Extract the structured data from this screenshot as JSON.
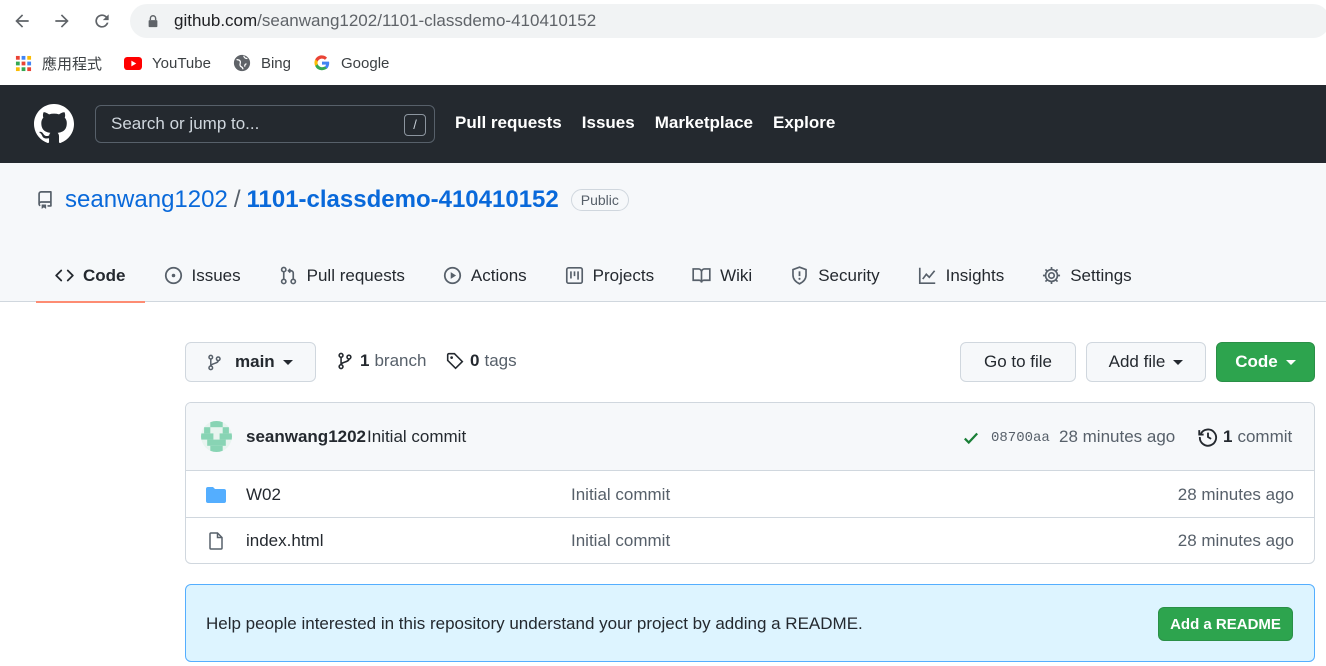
{
  "browser": {
    "url_host": "github.com",
    "url_path": "/seanwang1202/1101-classdemo-410410152",
    "bookmarks": [
      {
        "label": "應用程式",
        "icon": "apps-grid-icon"
      },
      {
        "label": "YouTube",
        "icon": "youtube-icon"
      },
      {
        "label": "Bing",
        "icon": "globe-icon"
      },
      {
        "label": "Google",
        "icon": "google-icon"
      }
    ]
  },
  "header": {
    "search_placeholder": "Search or jump to...",
    "search_shortcut": "/",
    "nav": [
      "Pull requests",
      "Issues",
      "Marketplace",
      "Explore"
    ]
  },
  "repo": {
    "owner": "seanwang1202",
    "separator": "/",
    "name": "1101-classdemo-410410152",
    "visibility": "Public",
    "tabs": [
      {
        "label": "Code",
        "icon": "code-icon",
        "active": true
      },
      {
        "label": "Issues",
        "icon": "issue-icon"
      },
      {
        "label": "Pull requests",
        "icon": "pull-request-icon"
      },
      {
        "label": "Actions",
        "icon": "play-icon"
      },
      {
        "label": "Projects",
        "icon": "project-icon"
      },
      {
        "label": "Wiki",
        "icon": "book-icon"
      },
      {
        "label": "Security",
        "icon": "shield-icon"
      },
      {
        "label": "Insights",
        "icon": "graph-icon"
      },
      {
        "label": "Settings",
        "icon": "gear-icon"
      }
    ]
  },
  "toolbar": {
    "branch": "main",
    "branch_count": "1",
    "branch_word": "branch",
    "tag_count": "0",
    "tag_word": "tags",
    "goto_file": "Go to file",
    "add_file": "Add file",
    "code": "Code"
  },
  "latest_commit": {
    "author": "seanwang1202",
    "message": "Initial commit",
    "sha": "08700aa",
    "age": "28 minutes ago",
    "commit_count": "1",
    "commit_word": "commit"
  },
  "files": [
    {
      "name": "W02",
      "type": "folder",
      "message": "Initial commit",
      "age": "28 minutes ago"
    },
    {
      "name": "index.html",
      "type": "file",
      "message": "Initial commit",
      "age": "28 minutes ago"
    }
  ],
  "readme_prompt": {
    "text": "Help people interested in this repository understand your project by adding a README.",
    "button": "Add a README"
  },
  "colors": {
    "header_bg": "#24292f",
    "link_blue": "#0969da",
    "primary_green": "#2da44e",
    "active_tab_underline": "#fd8c73",
    "readme_bg": "#ddf4ff"
  }
}
